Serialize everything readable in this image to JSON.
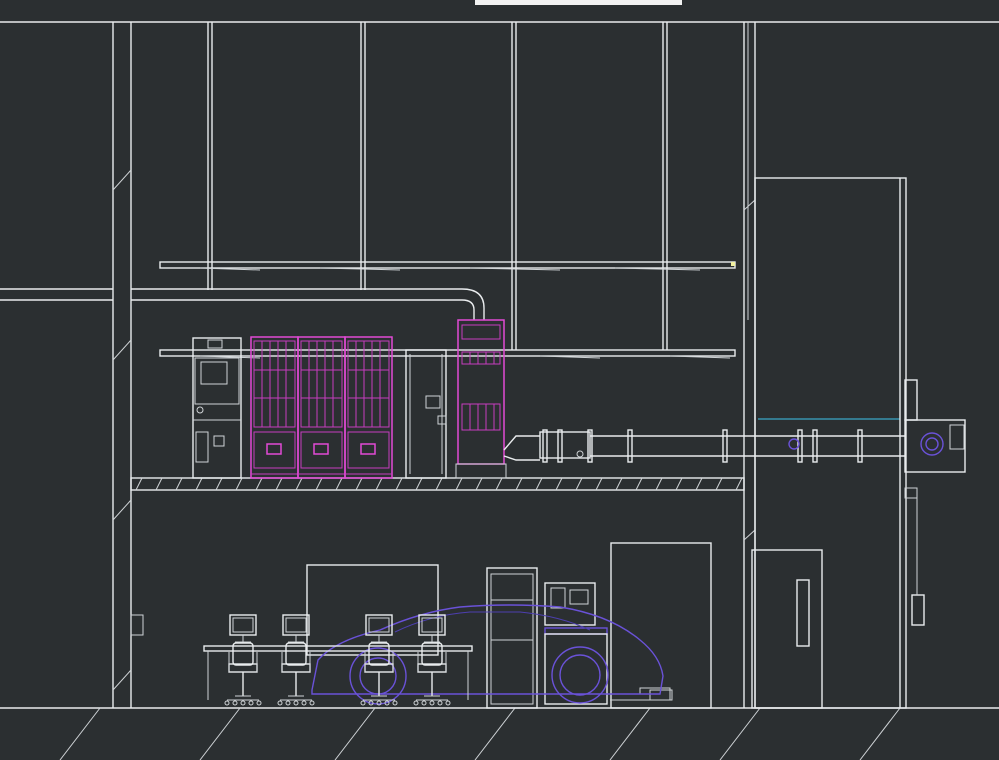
{
  "drawing": {
    "background": "#2b2f31",
    "line_color": "#e9ecee",
    "rack_color": "#e24ad6",
    "vehicle_color": "#6a52d8",
    "duct_accent_color": "#3aa8c8"
  },
  "elements": {
    "rack_count": 3,
    "workstation_count": 4,
    "duct_flange_count": 8
  }
}
